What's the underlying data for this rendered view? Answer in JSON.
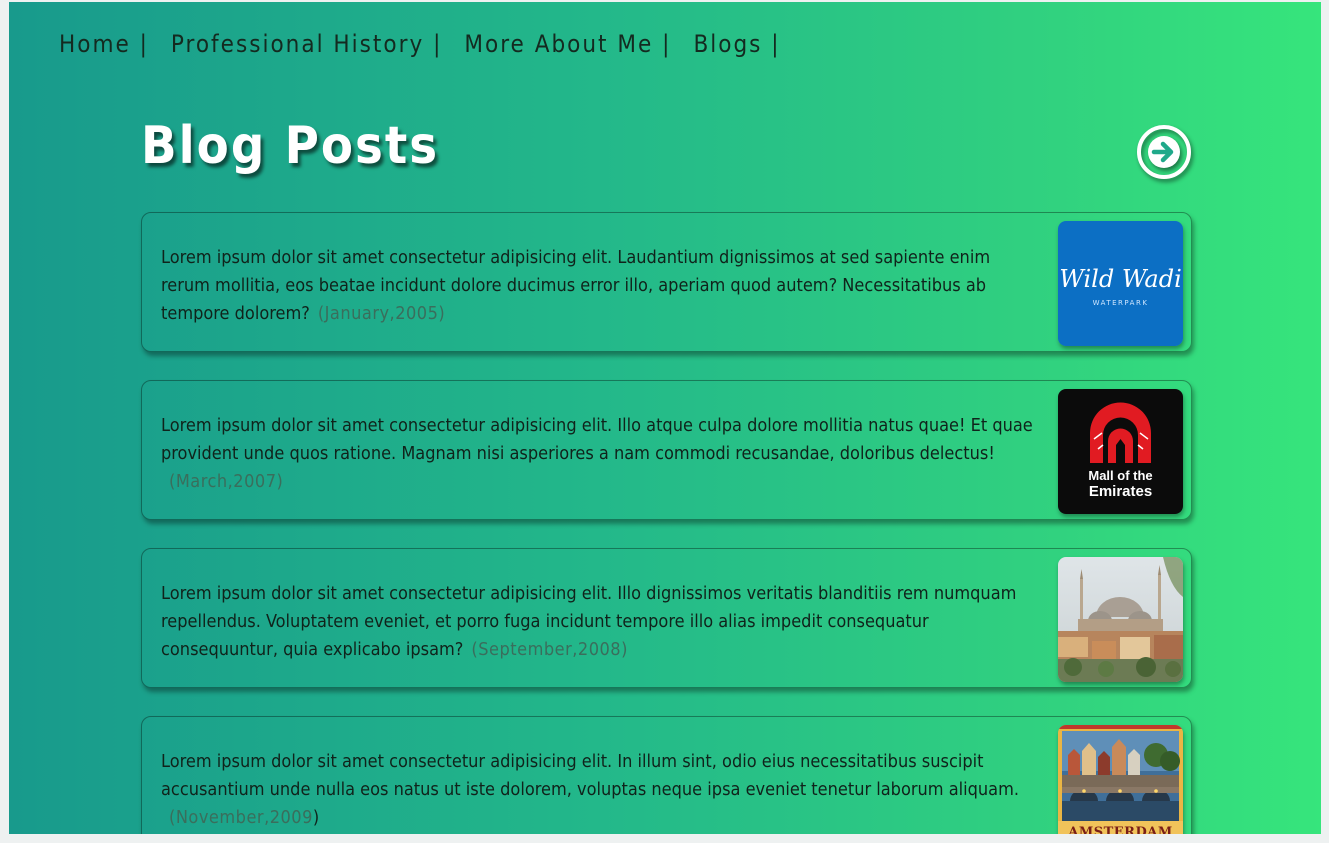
{
  "nav": {
    "items": [
      {
        "label": "Home |"
      },
      {
        "label": "Professional History |"
      },
      {
        "label": "More About Me |"
      },
      {
        "label": "Blogs |"
      }
    ]
  },
  "header": {
    "title": "Blog Posts",
    "next_icon": "arrow-right-circle-icon"
  },
  "posts": [
    {
      "text": "Lorem ipsum dolor sit amet consectetur adipisicing elit. Laudantium dignissimos at sed sapiente enim rerum mollitia, eos beatae incidunt dolore ducimus error illo, aperiam quod autem? Necessitatibus ab tempore dolorem?",
      "date": "(January,2005)",
      "thumb": {
        "type": "logo",
        "text": "Wild Wadi",
        "subtext": "WATERPARK",
        "bg": "#0c6fc4"
      }
    },
    {
      "text": "Lorem ipsum dolor sit amet consectetur adipisicing elit. Illo atque culpa dolore mollitia natus quae! Et quae provident unde quos ratione. Magnam nisi asperiores a nam commodi recusandae, doloribus delectus!",
      "date": "(March,2007)",
      "thumb": {
        "type": "logo",
        "text": "Mall of the",
        "subtext": "Emirates",
        "bg": "#0b0b0b"
      }
    },
    {
      "text": "Lorem ipsum dolor sit amet consectetur adipisicing elit. Illo dignissimos veritatis blanditiis rem numquam repellendus. Voluptatem eveniet, et porro fuga incidunt tempore illo alias impedit consequatur consequuntur, quia explicabo ipsam?",
      "date": "(September,2008)",
      "thumb": {
        "type": "photo",
        "subject": "mosque-cityscape"
      }
    },
    {
      "text": "Lorem ipsum dolor sit amet consectetur adipisicing elit. In illum sint, odio eius necessitatibus suscipit accusantium unde nulla eos natus ut iste dolorem, voluptas neque ipsa eveniet tenetur laborum aliquam.",
      "date": "(November,2009",
      "date_close": ")",
      "thumb": {
        "type": "photo",
        "subject": "amsterdam-canal",
        "caption": "AMSTERDAM"
      }
    }
  ]
}
